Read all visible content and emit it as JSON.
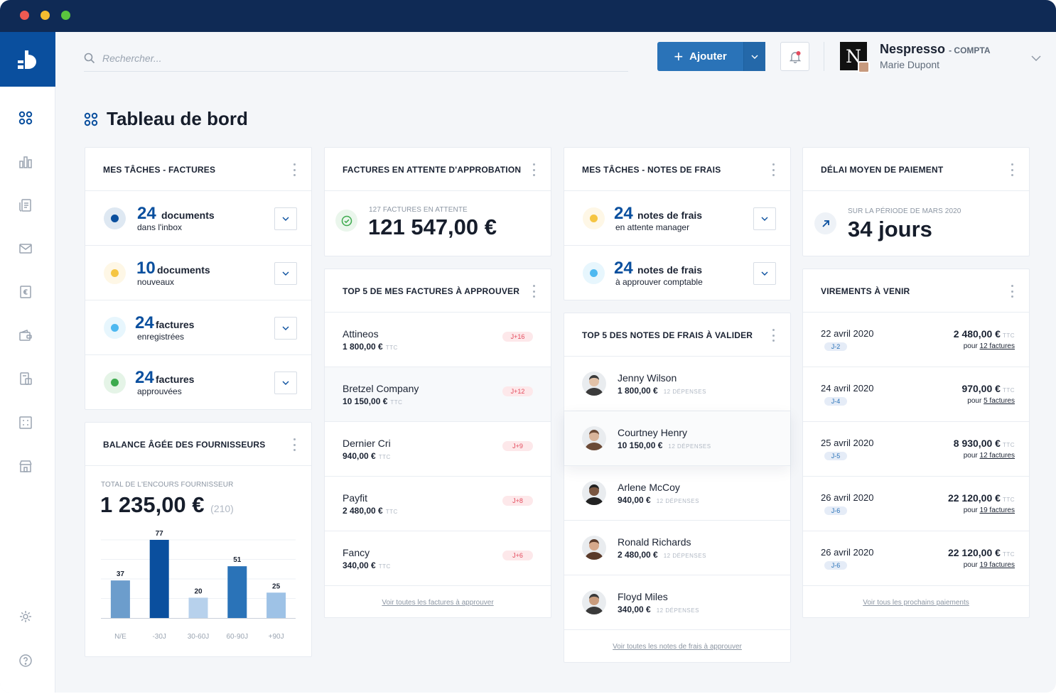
{
  "header": {
    "search_placeholder": "Rechercher...",
    "add_label": "Ajouter",
    "company": "Nespresso",
    "company_role": "- COMPTA",
    "company_logo_letter": "N",
    "user": "Marie Dupont"
  },
  "page": {
    "title": "Tableau de bord"
  },
  "colors": {
    "primary": "#0a4f9e",
    "accent": "#2a73b8",
    "titlebar": "#0f2a55",
    "badge_red": "#e34a5c"
  },
  "tasks_invoices": {
    "title": "MES TÂCHES - FACTURES",
    "items": [
      {
        "count": "24",
        "word": "documents",
        "sub": "dans l'inbox",
        "color": "#0a4f9e"
      },
      {
        "count": "10",
        "word": "documents",
        "sub": "nouveaux",
        "color": "#f5c542"
      },
      {
        "count": "24",
        "word": "factures",
        "sub": "enregistrées",
        "color": "#4db8f0"
      },
      {
        "count": "24",
        "word": "factures",
        "sub": "approuvées",
        "color": "#3daa4e"
      }
    ]
  },
  "pending": {
    "title": "FACTURES EN ATTENTE D'APPROBATION",
    "label": "127 FACTURES EN ATTENTE",
    "value": "121 547,00 €"
  },
  "tasks_expenses": {
    "title": "MES TÂCHES - NOTES DE FRAIS",
    "items": [
      {
        "count": "24",
        "word": "notes de frais",
        "sub": "en attente manager",
        "color": "#f5c542"
      },
      {
        "count": "24",
        "word": "notes de frais",
        "sub": "à approuver comptable",
        "color": "#4db8f0"
      }
    ]
  },
  "delay": {
    "title": "DÉLAI MOYEN DE PAIEMENT",
    "label": "SUR LA PÉRIODE DE MARS 2020",
    "value": "34 jours"
  },
  "top_invoices": {
    "title": "TOP 5 DE MES FACTURES À APPROUVER",
    "items": [
      {
        "name": "Attineos",
        "amount": "1 800,00 €",
        "ttc": "TTC",
        "tag": "J+16"
      },
      {
        "name": "Bretzel Company",
        "amount": "10 150,00 €",
        "ttc": "TTC",
        "tag": "J+12"
      },
      {
        "name": "Dernier Cri",
        "amount": "940,00 €",
        "ttc": "TTC",
        "tag": "J+9"
      },
      {
        "name": "Payfit",
        "amount": "2 480,00 €",
        "ttc": "TTC",
        "tag": "J+8"
      },
      {
        "name": "Fancy",
        "amount": "340,00 €",
        "ttc": "TTC",
        "tag": "J+6"
      }
    ],
    "link": "Voir toutes les factures à approuver"
  },
  "top_expenses": {
    "title": "TOP 5 DES NOTES DE FRAIS À VALIDER",
    "items": [
      {
        "name": "Jenny Wilson",
        "amount": "1 800,00 €",
        "sub": "12 DÉPENSES"
      },
      {
        "name": "Courtney Henry",
        "amount": "10 150,00 €",
        "sub": "12 DÉPENSES"
      },
      {
        "name": "Arlene McCoy",
        "amount": "940,00 €",
        "sub": "12 DÉPENSES"
      },
      {
        "name": "Ronald Richards",
        "amount": "2 480,00 €",
        "sub": "12 DÉPENSES"
      },
      {
        "name": "Floyd Miles",
        "amount": "340,00 €",
        "sub": "12 DÉPENSES"
      }
    ],
    "link": "Voir toutes les notes de frais à approuver"
  },
  "transfers": {
    "title": "VIREMENTS À VENIR",
    "items": [
      {
        "date": "22 avril 2020",
        "tag": "J-2",
        "amount": "2 480,00 €",
        "ttc": "TTC",
        "count_prefix": "pour",
        "count": "12 factures"
      },
      {
        "date": "24 avril 2020",
        "tag": "J-4",
        "amount": "970,00 €",
        "ttc": "TTC",
        "count_prefix": "pour",
        "count": "5 factures"
      },
      {
        "date": "25 avril 2020",
        "tag": "J-5",
        "amount": "8 930,00 €",
        "ttc": "TTC",
        "count_prefix": "pour",
        "count": "12 factures"
      },
      {
        "date": "26 avril 2020",
        "tag": "J-6",
        "amount": "22 120,00 €",
        "ttc": "TTC",
        "count_prefix": "pour",
        "count": "19 factures"
      },
      {
        "date": "26 avril 2020",
        "tag": "J-6",
        "amount": "22 120,00 €",
        "ttc": "TTC",
        "count_prefix": "pour",
        "count": "19 factures"
      }
    ],
    "link": "Voir tous les prochains paiements"
  },
  "balance": {
    "title": "BALANCE ÂGÉE DES FOURNISSEURS",
    "label": "TOTAL DE L'ENCOURS FOURNISSEUR",
    "value": "1 235,00 €",
    "count": "(210)"
  },
  "chart_data": {
    "type": "bar",
    "categories": [
      "N/E",
      "-30J",
      "30-60J",
      "60-90J",
      "+90J"
    ],
    "values": [
      37,
      77,
      20,
      51,
      25
    ],
    "colors": [
      "#6c9dcc",
      "#0a4f9e",
      "#b7d1ec",
      "#2a73b8",
      "#9ec2e6"
    ],
    "ylim": [
      0,
      77
    ],
    "grid": true
  }
}
